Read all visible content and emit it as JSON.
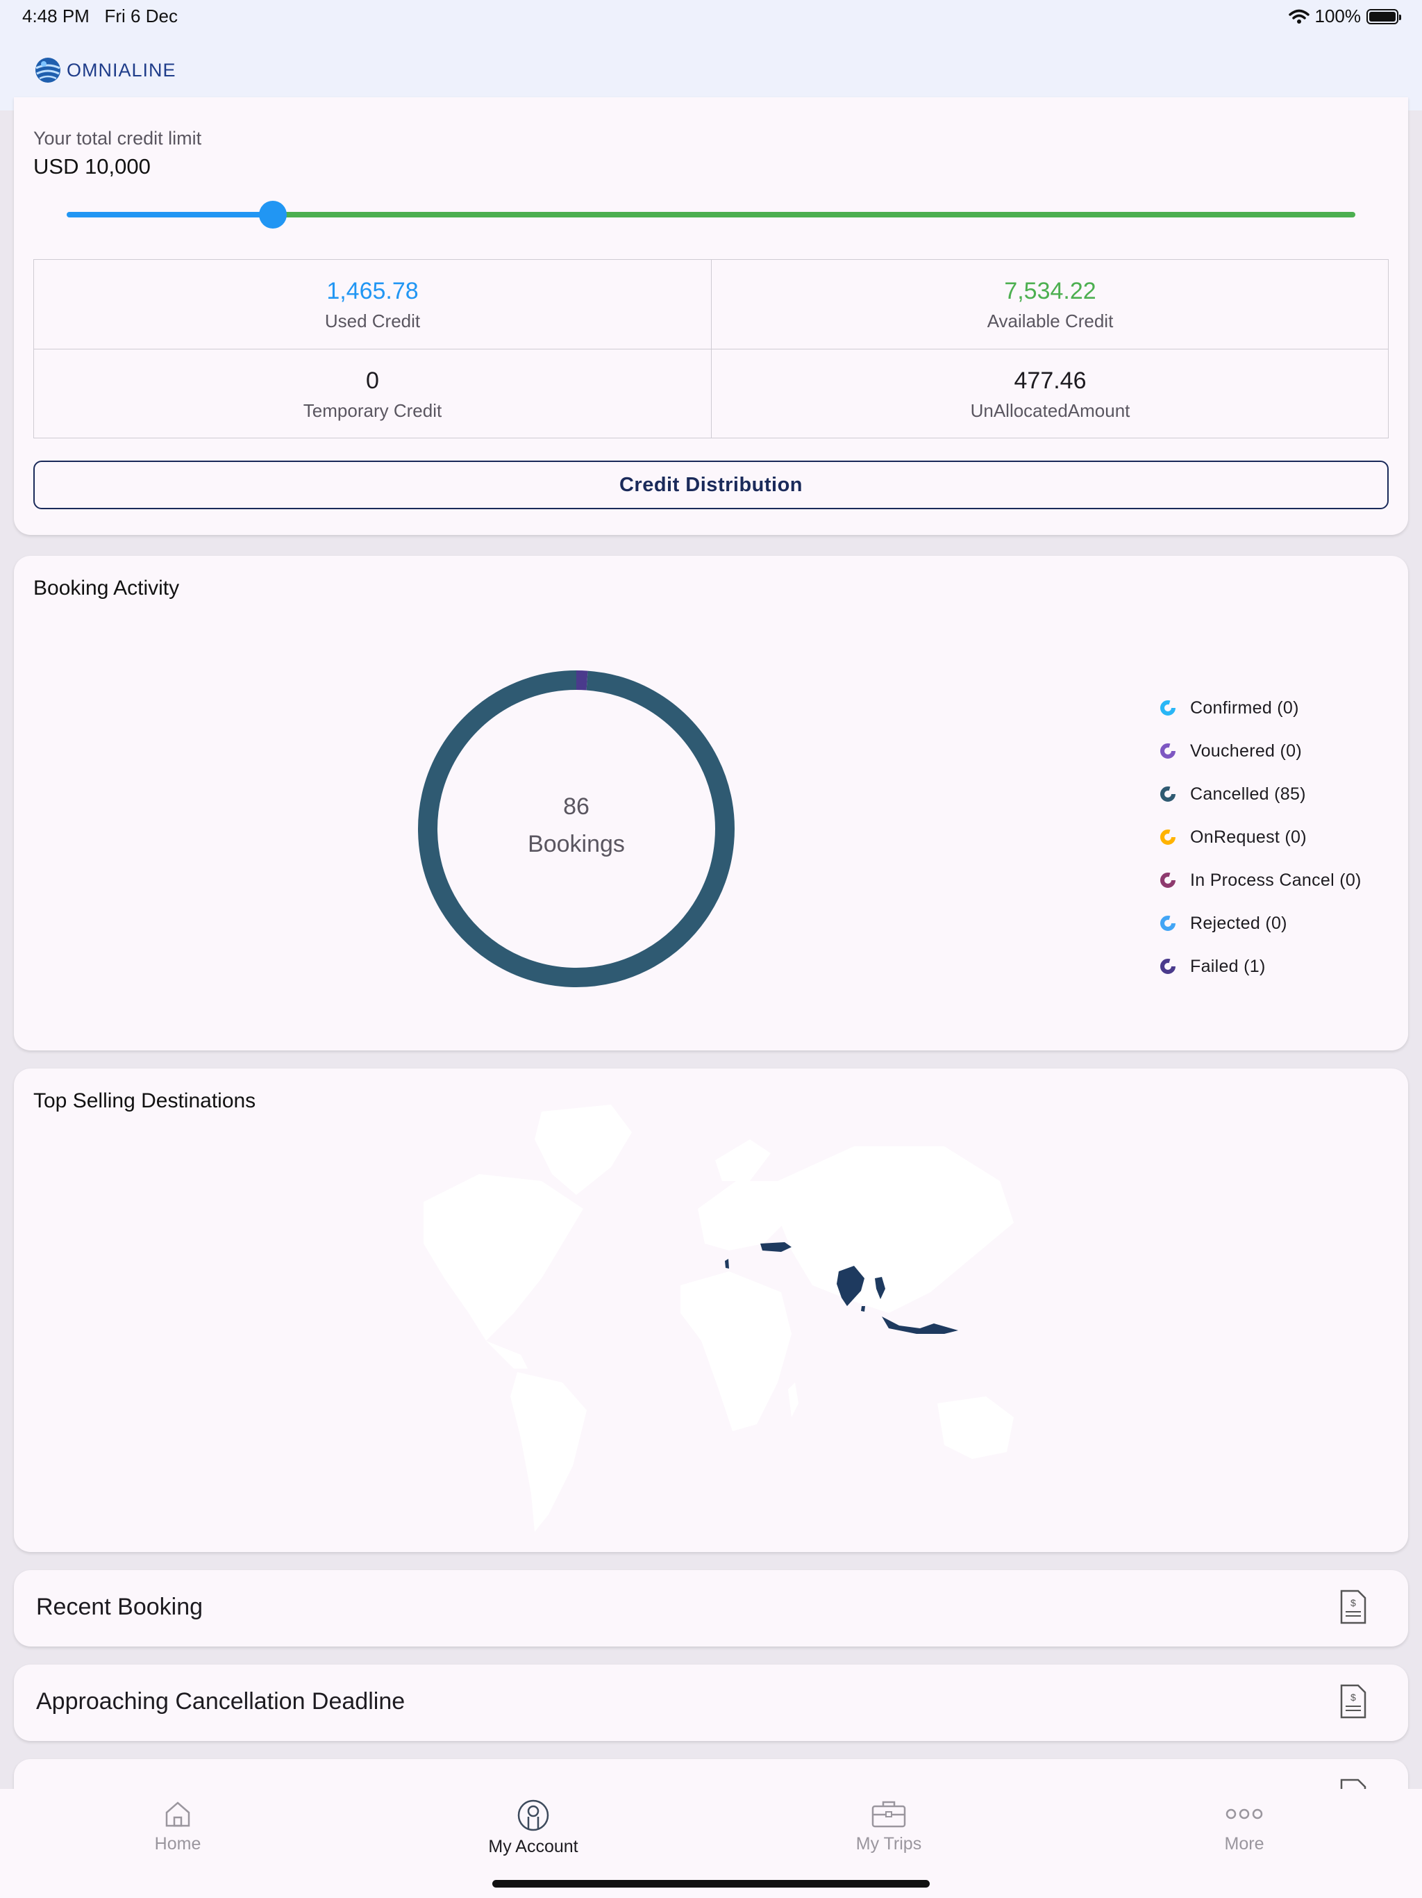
{
  "status_bar": {
    "time": "4:48 PM",
    "date": "Fri 6 Dec",
    "battery": "100%",
    "icons": [
      "wifi-icon",
      "battery-icon"
    ]
  },
  "header": {
    "logo_text": "OMNIALINE",
    "logo_icon": "globe-icon"
  },
  "credit": {
    "label": "Your total credit limit",
    "total": "USD 10,000",
    "slider_fraction": 0.16,
    "used_value": "1,465.78",
    "used_label": "Used Credit",
    "available_value": "7,534.22",
    "available_label": "Available Credit",
    "temporary_value": "0",
    "temporary_label": "Temporary Credit",
    "unallocated_value": "477.46",
    "unallocated_label": "UnAllocatedAmount",
    "distribution_button": "Credit Distribution",
    "colors": {
      "used": "#2196f3",
      "available": "#4caf50"
    }
  },
  "booking_activity": {
    "title": "Booking Activity",
    "total_count": "86",
    "total_label": "Bookings",
    "legend": [
      {
        "label": "Confirmed (0)",
        "color": "#29b6f6",
        "value": 0
      },
      {
        "label": "Vouchered (0)",
        "color": "#7e57c2",
        "value": 0
      },
      {
        "label": "Cancelled (85)",
        "color": "#2f5a72",
        "value": 85
      },
      {
        "label": "OnRequest (0)",
        "color": "#ffb300",
        "value": 0
      },
      {
        "label": "In Process Cancel (0)",
        "color": "#8e3a6e",
        "value": 0
      },
      {
        "label": "Rejected (0)",
        "color": "#42a5f5",
        "value": 0
      },
      {
        "label": "Failed (1)",
        "color": "#4a3a8c",
        "value": 1
      }
    ]
  },
  "top_destinations": {
    "title": "Top Selling Destinations",
    "highlight_color": "#1e3a5f"
  },
  "sections": [
    {
      "label": "Recent Booking",
      "icon": "invoice-icon"
    },
    {
      "label": "Approaching Cancellation Deadline",
      "icon": "invoice-icon"
    }
  ],
  "bottom_nav": [
    {
      "label": "Home",
      "icon": "home-icon",
      "active": false
    },
    {
      "label": "My Account",
      "icon": "account-icon",
      "active": true
    },
    {
      "label": "My Trips",
      "icon": "briefcase-icon",
      "active": false
    },
    {
      "label": "More",
      "icon": "more-icon",
      "active": false
    }
  ]
}
